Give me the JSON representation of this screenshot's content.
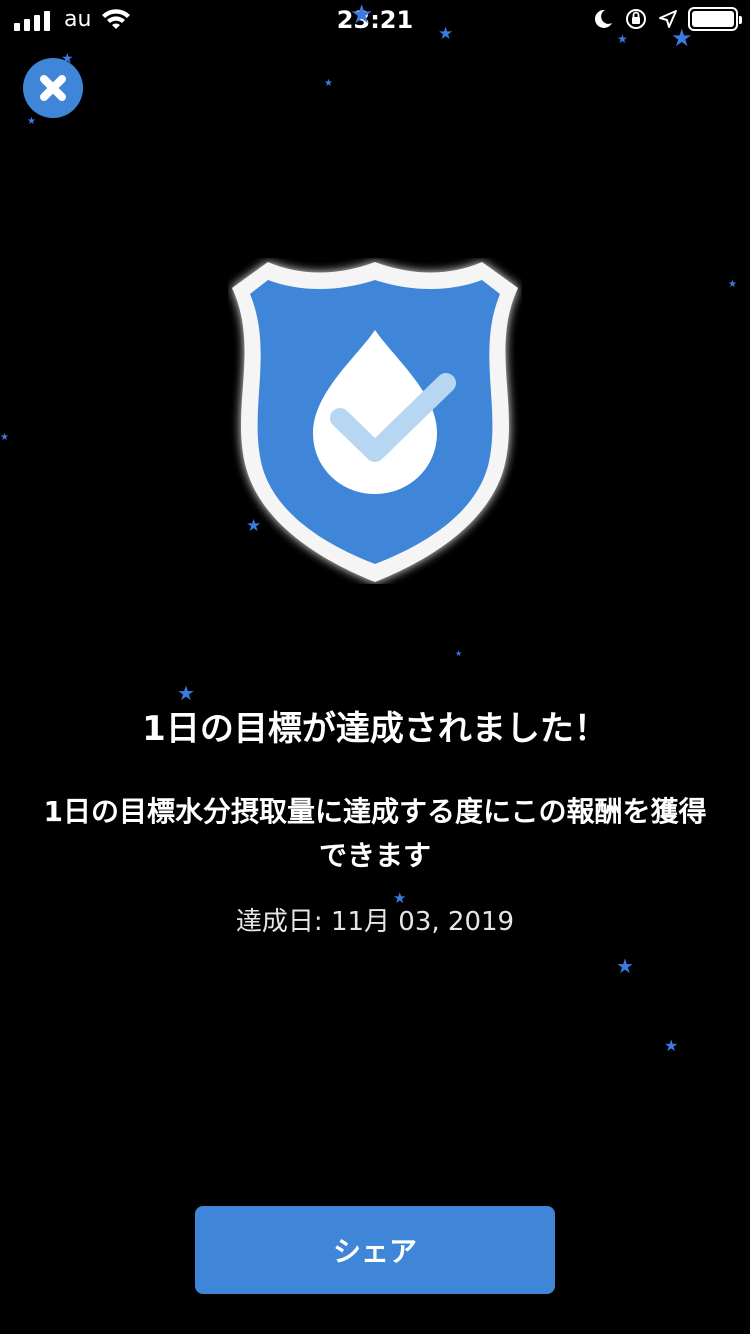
{
  "status_bar": {
    "carrier": "au",
    "time": "23:21"
  },
  "achievement": {
    "title": "1日の目標が達成されました！",
    "description": "1日の目標水分摂取量に達成する度にこの報酬を獲得できます",
    "date_label": "達成日: 11月 03, 2019"
  },
  "share_button": {
    "label": "シェア"
  },
  "icons": {
    "close": "close-icon",
    "badge": "shield-water-drop-check-icon",
    "star": "star-icon"
  },
  "colors": {
    "background": "#000000",
    "accent": "#3f86d8",
    "shield_blue": "#3f86d8",
    "star_blue": "#3b7be0",
    "check_light_blue": "#b7d6f2"
  }
}
